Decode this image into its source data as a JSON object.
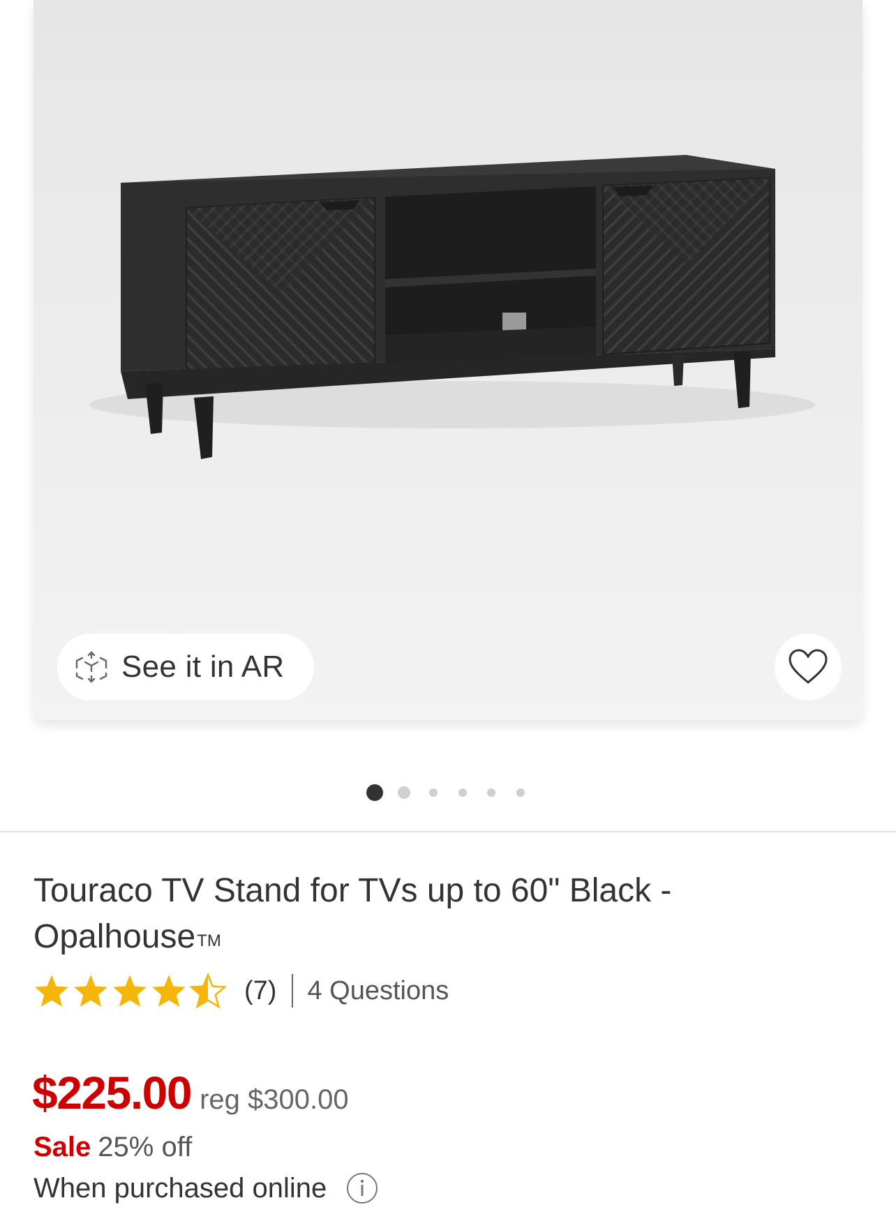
{
  "hero": {
    "ar_label": "See it in AR",
    "dots": [
      {
        "active": true
      },
      {
        "active": false
      },
      {
        "active": false
      },
      {
        "active": false
      },
      {
        "active": false
      },
      {
        "active": false
      }
    ]
  },
  "product": {
    "title": "Touraco TV Stand for TVs up to 60\" Black - Opalhouse",
    "trademark": "TM",
    "rating": 4.5,
    "review_count": "(7)",
    "questions": "4 Questions",
    "price": "$225.00",
    "reg_price": "reg $300.00",
    "sale_label": "Sale",
    "discount": "25% off",
    "online_note": "When purchased online"
  },
  "colors": {
    "price_red": "#cc0000",
    "star_gold": "#f5b50a",
    "text": "#333333"
  },
  "icons": [
    "ar-cube-icon",
    "heart-icon",
    "star-icon",
    "info-icon"
  ]
}
